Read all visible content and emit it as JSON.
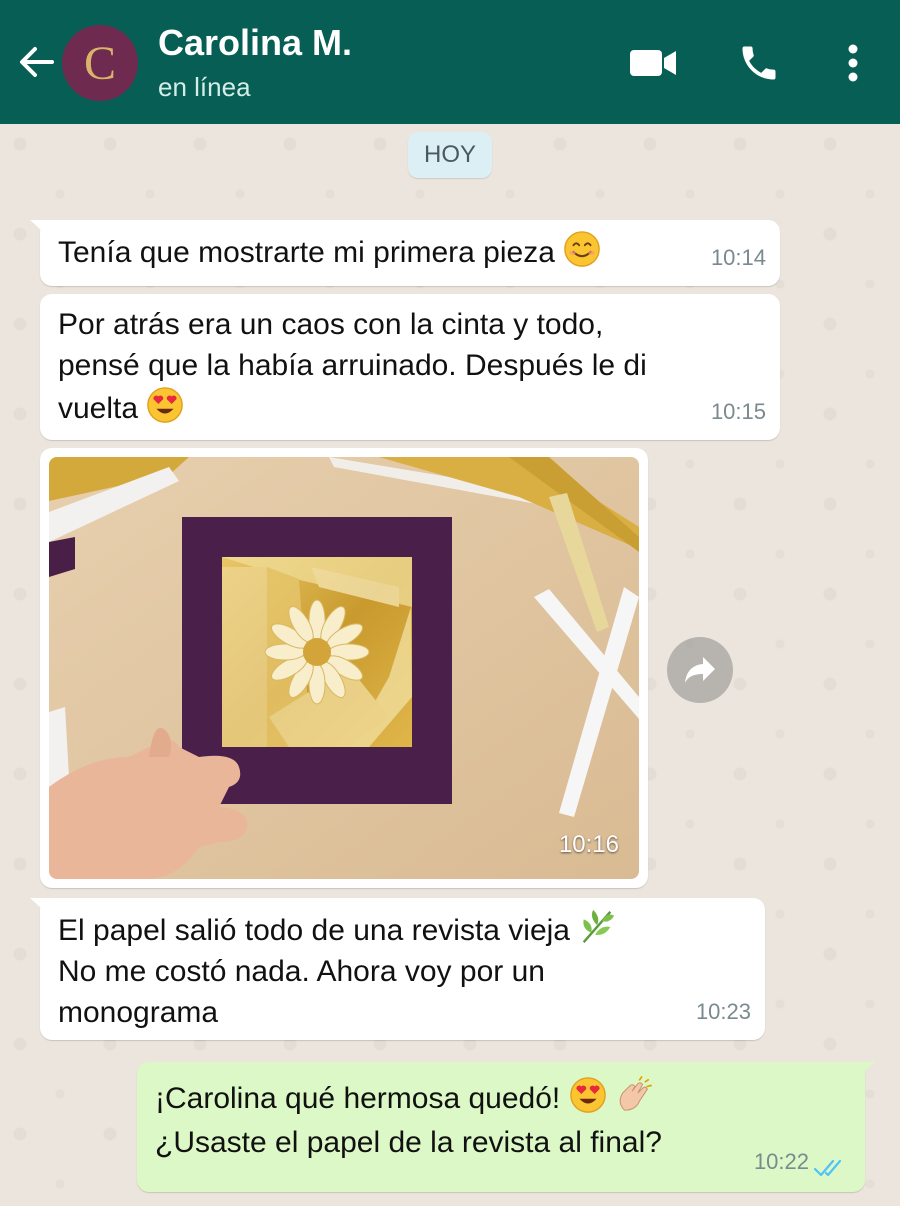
{
  "header": {
    "avatar_letter": "C",
    "contact_name": "Carolina M.",
    "status": "en línea",
    "icons": [
      "back-arrow-icon",
      "video-call-icon",
      "phone-icon",
      "more-vert-icon"
    ]
  },
  "chat": {
    "date_label": "HOY",
    "messages": [
      {
        "direction": "in",
        "lines": [
          "Tenía que mostrarte mi primera pieza"
        ],
        "emoji": [
          "smiling-face-emoji"
        ],
        "time": "10:14"
      },
      {
        "direction": "in",
        "lines": [
          "Por atrás era un caos con la cinta y todo,",
          "pensé que la había arruinado. Después le di",
          "vuelta"
        ],
        "emoji": [
          "heart-eyes-emoji"
        ],
        "time": "10:15"
      },
      {
        "direction": "in",
        "type": "image",
        "image_description": "iris folding daisy card",
        "time": "10:16"
      },
      {
        "direction": "in",
        "lines": [
          "El papel salió todo de una revista vieja",
          "No me costó nada. Ahora voy por un",
          "monograma"
        ],
        "emoji": [
          "herb-emoji"
        ],
        "time": "10:23"
      },
      {
        "direction": "out",
        "lines": [
          "¡Carolina qué hermosa quedó!",
          "¿Usaste el papel de la revista al final?"
        ],
        "emoji": [
          "heart-eyes-emoji",
          "clapping-hands-emoji"
        ],
        "time": "10:22",
        "status": "read"
      }
    ]
  },
  "colors": {
    "header_bg": "#075e54",
    "chat_bg": "#ece5dd",
    "incoming_bubble": "#ffffff",
    "outgoing_bubble": "#dcf8c6",
    "read_ticks": "#4fc3f7"
  }
}
